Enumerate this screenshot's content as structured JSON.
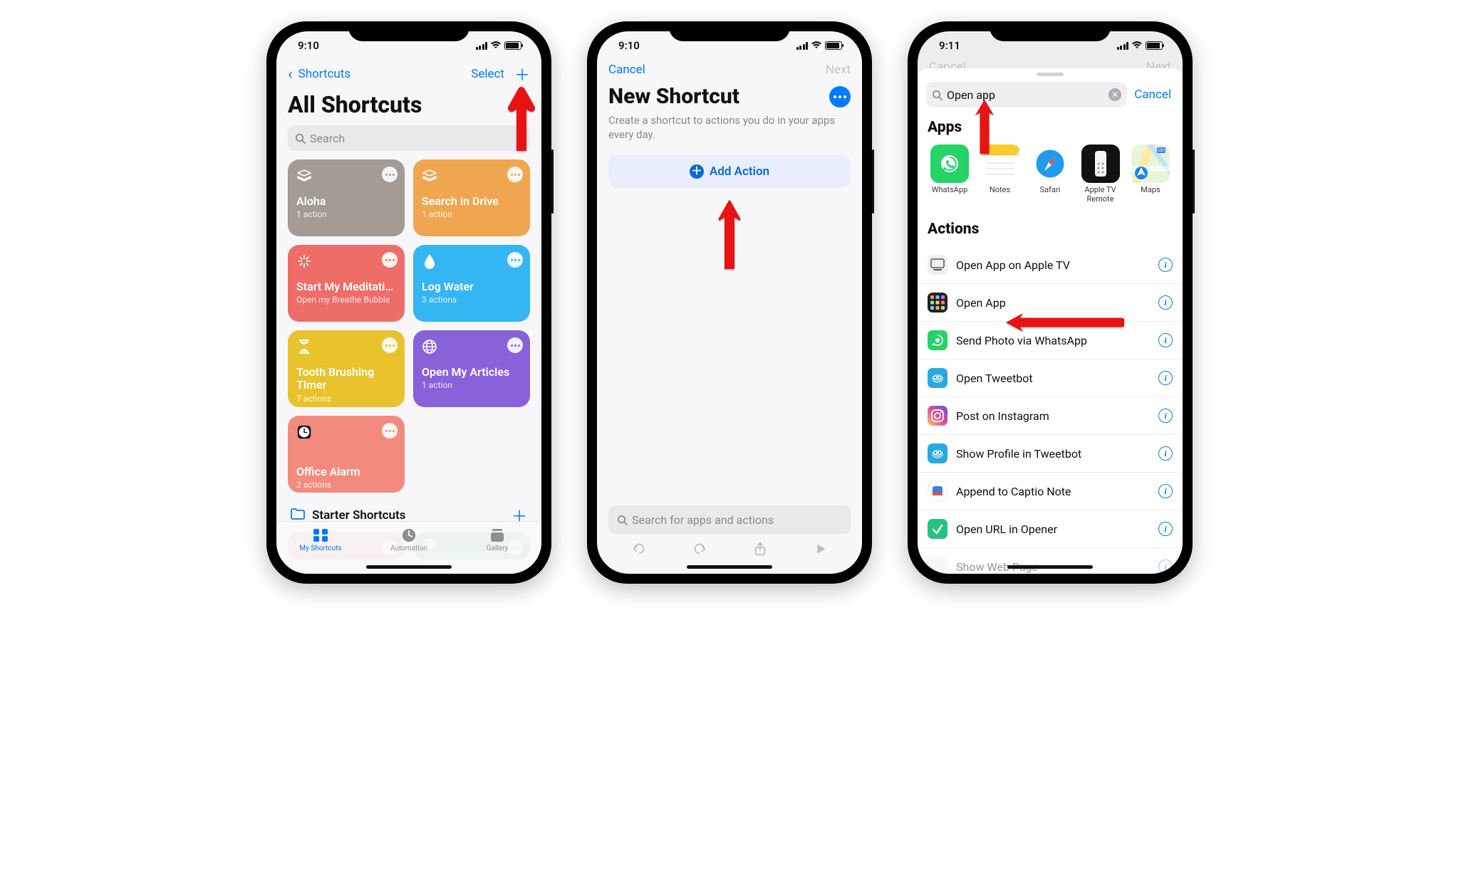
{
  "status": {
    "time1": "9:10",
    "time2": "9:10",
    "time3": "9:11"
  },
  "screen1": {
    "back": "Shortcuts",
    "select": "Select",
    "title": "All Shortcuts",
    "search_ph": "Search",
    "folder": "Starter Shortcuts",
    "tabs": {
      "my": "My Shortcuts",
      "auto": "Automation",
      "gallery": "Gallery"
    },
    "tiles": [
      {
        "label": "Aloha",
        "sub": "1 action"
      },
      {
        "label": "Search in Drive",
        "sub": "1 action"
      },
      {
        "label": "Start My Meditation Ses...",
        "sub": "Open my Breathe Bubble"
      },
      {
        "label": "Log Water",
        "sub": "3 actions"
      },
      {
        "label": "Tooth Brushing Timer",
        "sub": "7 actions"
      },
      {
        "label": "Open My Articles",
        "sub": "1 action"
      },
      {
        "label": "Office Alarm",
        "sub": "2 actions"
      }
    ]
  },
  "screen2": {
    "cancel": "Cancel",
    "next": "Next",
    "title": "New Shortcut",
    "desc": "Create a shortcut to actions you do in your apps every day.",
    "add": "Add Action",
    "search_ph": "Search for apps and actions"
  },
  "screen3": {
    "dim_cancel": "Cancel",
    "dim_next": "Next",
    "query": "Open app",
    "cancel": "Cancel",
    "apps_h": "Apps",
    "actions_h": "Actions",
    "apps": [
      {
        "name": "WhatsApp"
      },
      {
        "name": "Notes"
      },
      {
        "name": "Safari"
      },
      {
        "name": "Apple TV Remote"
      },
      {
        "name": "Maps"
      }
    ],
    "actions": [
      {
        "name": "Open App on Apple TV"
      },
      {
        "name": "Open App"
      },
      {
        "name": "Send Photo via WhatsApp"
      },
      {
        "name": "Open Tweetbot"
      },
      {
        "name": "Post on Instagram"
      },
      {
        "name": "Show Profile in Tweetbot"
      },
      {
        "name": "Append to Captio Note"
      },
      {
        "name": "Open URL in Opener"
      },
      {
        "name": "Show Web Page"
      }
    ]
  }
}
